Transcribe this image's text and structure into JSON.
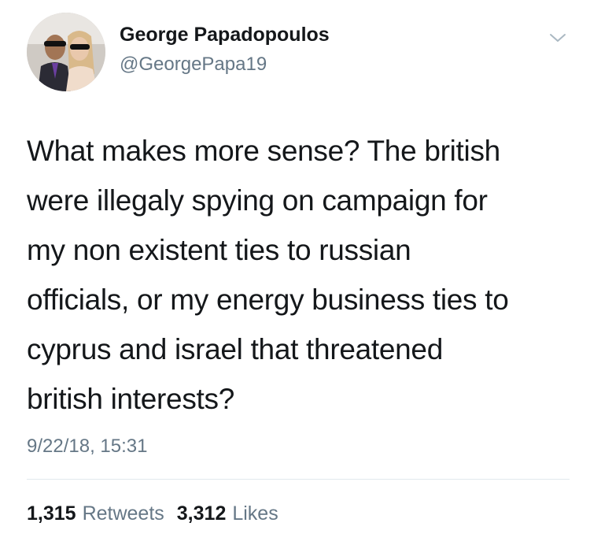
{
  "author": {
    "display_name": "George Papadopoulos",
    "handle": "@GeorgePapa19",
    "avatar_icon": "profile-photo-avatar"
  },
  "menu_icon": "chevron-down-icon",
  "tweet": {
    "text": "What makes more sense? The british\nwere illegaly spying on campaign for\nmy non existent ties to russian\nofficials, or my energy business ties to\ncyprus and israel that threatened\nbritish interests?",
    "timestamp": "9/22/18, 15:31"
  },
  "stats": {
    "retweets_count": "1,315",
    "retweets_label": "Retweets",
    "likes_count": "3,312",
    "likes_label": "Likes"
  },
  "colors": {
    "text": "#14171a",
    "secondary": "#657786",
    "divider": "#e1e8ed"
  }
}
